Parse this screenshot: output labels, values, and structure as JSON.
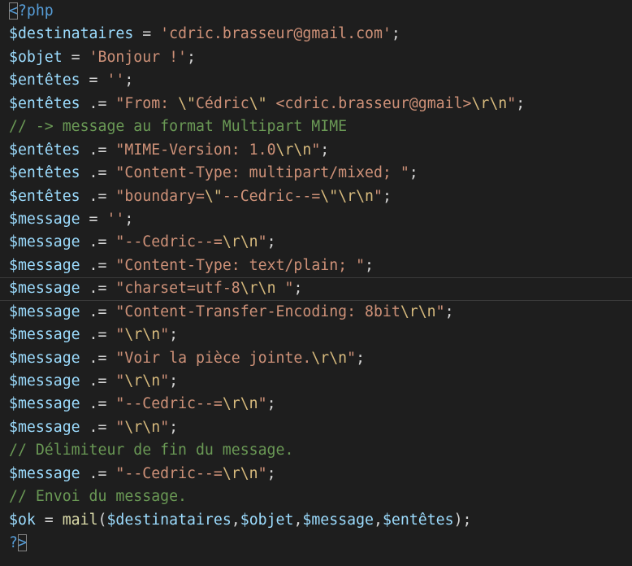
{
  "editor": {
    "language": "php",
    "current_line_index": 12,
    "colors": {
      "background": "#1e1e1e",
      "variable": "#9cdcfe",
      "string": "#ce9178",
      "escape": "#d7ba7d",
      "comment": "#6a9955",
      "tag": "#569cd6",
      "function": "#dcdcaa",
      "default": "#d4d4d4"
    },
    "lines": [
      {
        "tokens": [
          {
            "t": "<",
            "k": "tag",
            "match": true
          },
          {
            "t": "?php",
            "k": "tag"
          }
        ]
      },
      {
        "tokens": [
          {
            "t": "$destinataires",
            "k": "var"
          },
          {
            "t": " = ",
            "k": "op"
          },
          {
            "t": "'cdric.brasseur@gmail.com'",
            "k": "str"
          },
          {
            "t": ";",
            "k": "punct"
          }
        ]
      },
      {
        "tokens": [
          {
            "t": "$objet",
            "k": "var"
          },
          {
            "t": " = ",
            "k": "op"
          },
          {
            "t": "'Bonjour !'",
            "k": "str"
          },
          {
            "t": ";",
            "k": "punct"
          }
        ]
      },
      {
        "tokens": [
          {
            "t": "$entêtes",
            "k": "var"
          },
          {
            "t": " = ",
            "k": "op"
          },
          {
            "t": "''",
            "k": "str"
          },
          {
            "t": ";",
            "k": "punct"
          }
        ]
      },
      {
        "tokens": [
          {
            "t": "$entêtes",
            "k": "var"
          },
          {
            "t": " .= ",
            "k": "op"
          },
          {
            "t": "\"From: ",
            "k": "str"
          },
          {
            "t": "\\\"",
            "k": "esc"
          },
          {
            "t": "Cédric",
            "k": "str"
          },
          {
            "t": "\\\"",
            "k": "esc"
          },
          {
            "t": " <cdric.brasseur@gmail>",
            "k": "str"
          },
          {
            "t": "\\r\\n",
            "k": "esc"
          },
          {
            "t": "\"",
            "k": "str"
          },
          {
            "t": ";",
            "k": "punct"
          }
        ]
      },
      {
        "tokens": [
          {
            "t": "// -> message au format Multipart MIME",
            "k": "comment"
          }
        ]
      },
      {
        "tokens": [
          {
            "t": "$entêtes",
            "k": "var"
          },
          {
            "t": " .= ",
            "k": "op"
          },
          {
            "t": "\"MIME-Version: 1.0",
            "k": "str"
          },
          {
            "t": "\\r\\n",
            "k": "esc"
          },
          {
            "t": "\"",
            "k": "str"
          },
          {
            "t": ";",
            "k": "punct"
          }
        ]
      },
      {
        "tokens": [
          {
            "t": "$entêtes",
            "k": "var"
          },
          {
            "t": " .= ",
            "k": "op"
          },
          {
            "t": "\"Content-Type: multipart/mixed; \"",
            "k": "str"
          },
          {
            "t": ";",
            "k": "punct"
          }
        ]
      },
      {
        "tokens": [
          {
            "t": "$entêtes",
            "k": "var"
          },
          {
            "t": " .= ",
            "k": "op"
          },
          {
            "t": "\"boundary=",
            "k": "str"
          },
          {
            "t": "\\\"",
            "k": "esc"
          },
          {
            "t": "--Cedric--=",
            "k": "str"
          },
          {
            "t": "\\\"",
            "k": "esc"
          },
          {
            "t": "\\r\\n",
            "k": "esc"
          },
          {
            "t": "\"",
            "k": "str"
          },
          {
            "t": ";",
            "k": "punct"
          }
        ]
      },
      {
        "tokens": [
          {
            "t": "$message",
            "k": "var"
          },
          {
            "t": " = ",
            "k": "op"
          },
          {
            "t": "''",
            "k": "str"
          },
          {
            "t": ";",
            "k": "punct"
          }
        ]
      },
      {
        "tokens": [
          {
            "t": "$message",
            "k": "var"
          },
          {
            "t": " .= ",
            "k": "op"
          },
          {
            "t": "\"--Cedric--=",
            "k": "str"
          },
          {
            "t": "\\r\\n",
            "k": "esc"
          },
          {
            "t": "\"",
            "k": "str"
          },
          {
            "t": ";",
            "k": "punct"
          }
        ]
      },
      {
        "tokens": [
          {
            "t": "$message",
            "k": "var"
          },
          {
            "t": " .= ",
            "k": "op"
          },
          {
            "t": "\"Content-Type: text/plain; \"",
            "k": "str"
          },
          {
            "t": ";",
            "k": "punct"
          }
        ]
      },
      {
        "tokens": [
          {
            "t": "$message",
            "k": "var"
          },
          {
            "t": " .= ",
            "k": "op"
          },
          {
            "t": "\"charset=utf-8",
            "k": "str"
          },
          {
            "t": "\\r\\n",
            "k": "esc"
          },
          {
            "t": " \"",
            "k": "str"
          },
          {
            "t": ";",
            "k": "punct"
          }
        ]
      },
      {
        "tokens": [
          {
            "t": "$message",
            "k": "var"
          },
          {
            "t": " .= ",
            "k": "op"
          },
          {
            "t": "\"Content-Transfer-Encoding: 8bit",
            "k": "str"
          },
          {
            "t": "\\r\\n",
            "k": "esc"
          },
          {
            "t": "\"",
            "k": "str"
          },
          {
            "t": ";",
            "k": "punct"
          }
        ]
      },
      {
        "tokens": [
          {
            "t": "$message",
            "k": "var"
          },
          {
            "t": " .= ",
            "k": "op"
          },
          {
            "t": "\"",
            "k": "str"
          },
          {
            "t": "\\r\\n",
            "k": "esc"
          },
          {
            "t": "\"",
            "k": "str"
          },
          {
            "t": ";",
            "k": "punct"
          }
        ]
      },
      {
        "tokens": [
          {
            "t": "$message",
            "k": "var"
          },
          {
            "t": " .= ",
            "k": "op"
          },
          {
            "t": "\"Voir la pièce jointe.",
            "k": "str"
          },
          {
            "t": "\\r\\n",
            "k": "esc"
          },
          {
            "t": "\"",
            "k": "str"
          },
          {
            "t": ";",
            "k": "punct"
          }
        ]
      },
      {
        "tokens": [
          {
            "t": "$message",
            "k": "var"
          },
          {
            "t": " .= ",
            "k": "op"
          },
          {
            "t": "\"",
            "k": "str"
          },
          {
            "t": "\\r\\n",
            "k": "esc"
          },
          {
            "t": "\"",
            "k": "str"
          },
          {
            "t": ";",
            "k": "punct"
          }
        ]
      },
      {
        "tokens": [
          {
            "t": "$message",
            "k": "var"
          },
          {
            "t": " .= ",
            "k": "op"
          },
          {
            "t": "\"--Cedric--=",
            "k": "str"
          },
          {
            "t": "\\r\\n",
            "k": "esc"
          },
          {
            "t": "\"",
            "k": "str"
          },
          {
            "t": ";",
            "k": "punct"
          }
        ]
      },
      {
        "tokens": [
          {
            "t": "$message",
            "k": "var"
          },
          {
            "t": " .= ",
            "k": "op"
          },
          {
            "t": "\"",
            "k": "str"
          },
          {
            "t": "\\r\\n",
            "k": "esc"
          },
          {
            "t": "\"",
            "k": "str"
          },
          {
            "t": ";",
            "k": "punct"
          }
        ]
      },
      {
        "tokens": [
          {
            "t": "// Délimiteur de fin du message.",
            "k": "comment"
          }
        ]
      },
      {
        "tokens": [
          {
            "t": "$message",
            "k": "var"
          },
          {
            "t": " .= ",
            "k": "op"
          },
          {
            "t": "\"--Cedric--=",
            "k": "str"
          },
          {
            "t": "\\r\\n",
            "k": "esc"
          },
          {
            "t": "\"",
            "k": "str"
          },
          {
            "t": ";",
            "k": "punct"
          }
        ]
      },
      {
        "tokens": [
          {
            "t": "// Envoi du message.",
            "k": "comment"
          }
        ]
      },
      {
        "tokens": [
          {
            "t": "$ok",
            "k": "var"
          },
          {
            "t": " = ",
            "k": "op"
          },
          {
            "t": "mail",
            "k": "func"
          },
          {
            "t": "(",
            "k": "punct"
          },
          {
            "t": "$destinataires",
            "k": "var"
          },
          {
            "t": ",",
            "k": "punct"
          },
          {
            "t": "$objet",
            "k": "var"
          },
          {
            "t": ",",
            "k": "punct"
          },
          {
            "t": "$message",
            "k": "var"
          },
          {
            "t": ",",
            "k": "punct"
          },
          {
            "t": "$entêtes",
            "k": "var"
          },
          {
            "t": ");",
            "k": "punct"
          }
        ]
      },
      {
        "tokens": [
          {
            "t": "?",
            "k": "tag"
          },
          {
            "t": ">",
            "k": "tag",
            "match": true
          }
        ]
      }
    ]
  }
}
